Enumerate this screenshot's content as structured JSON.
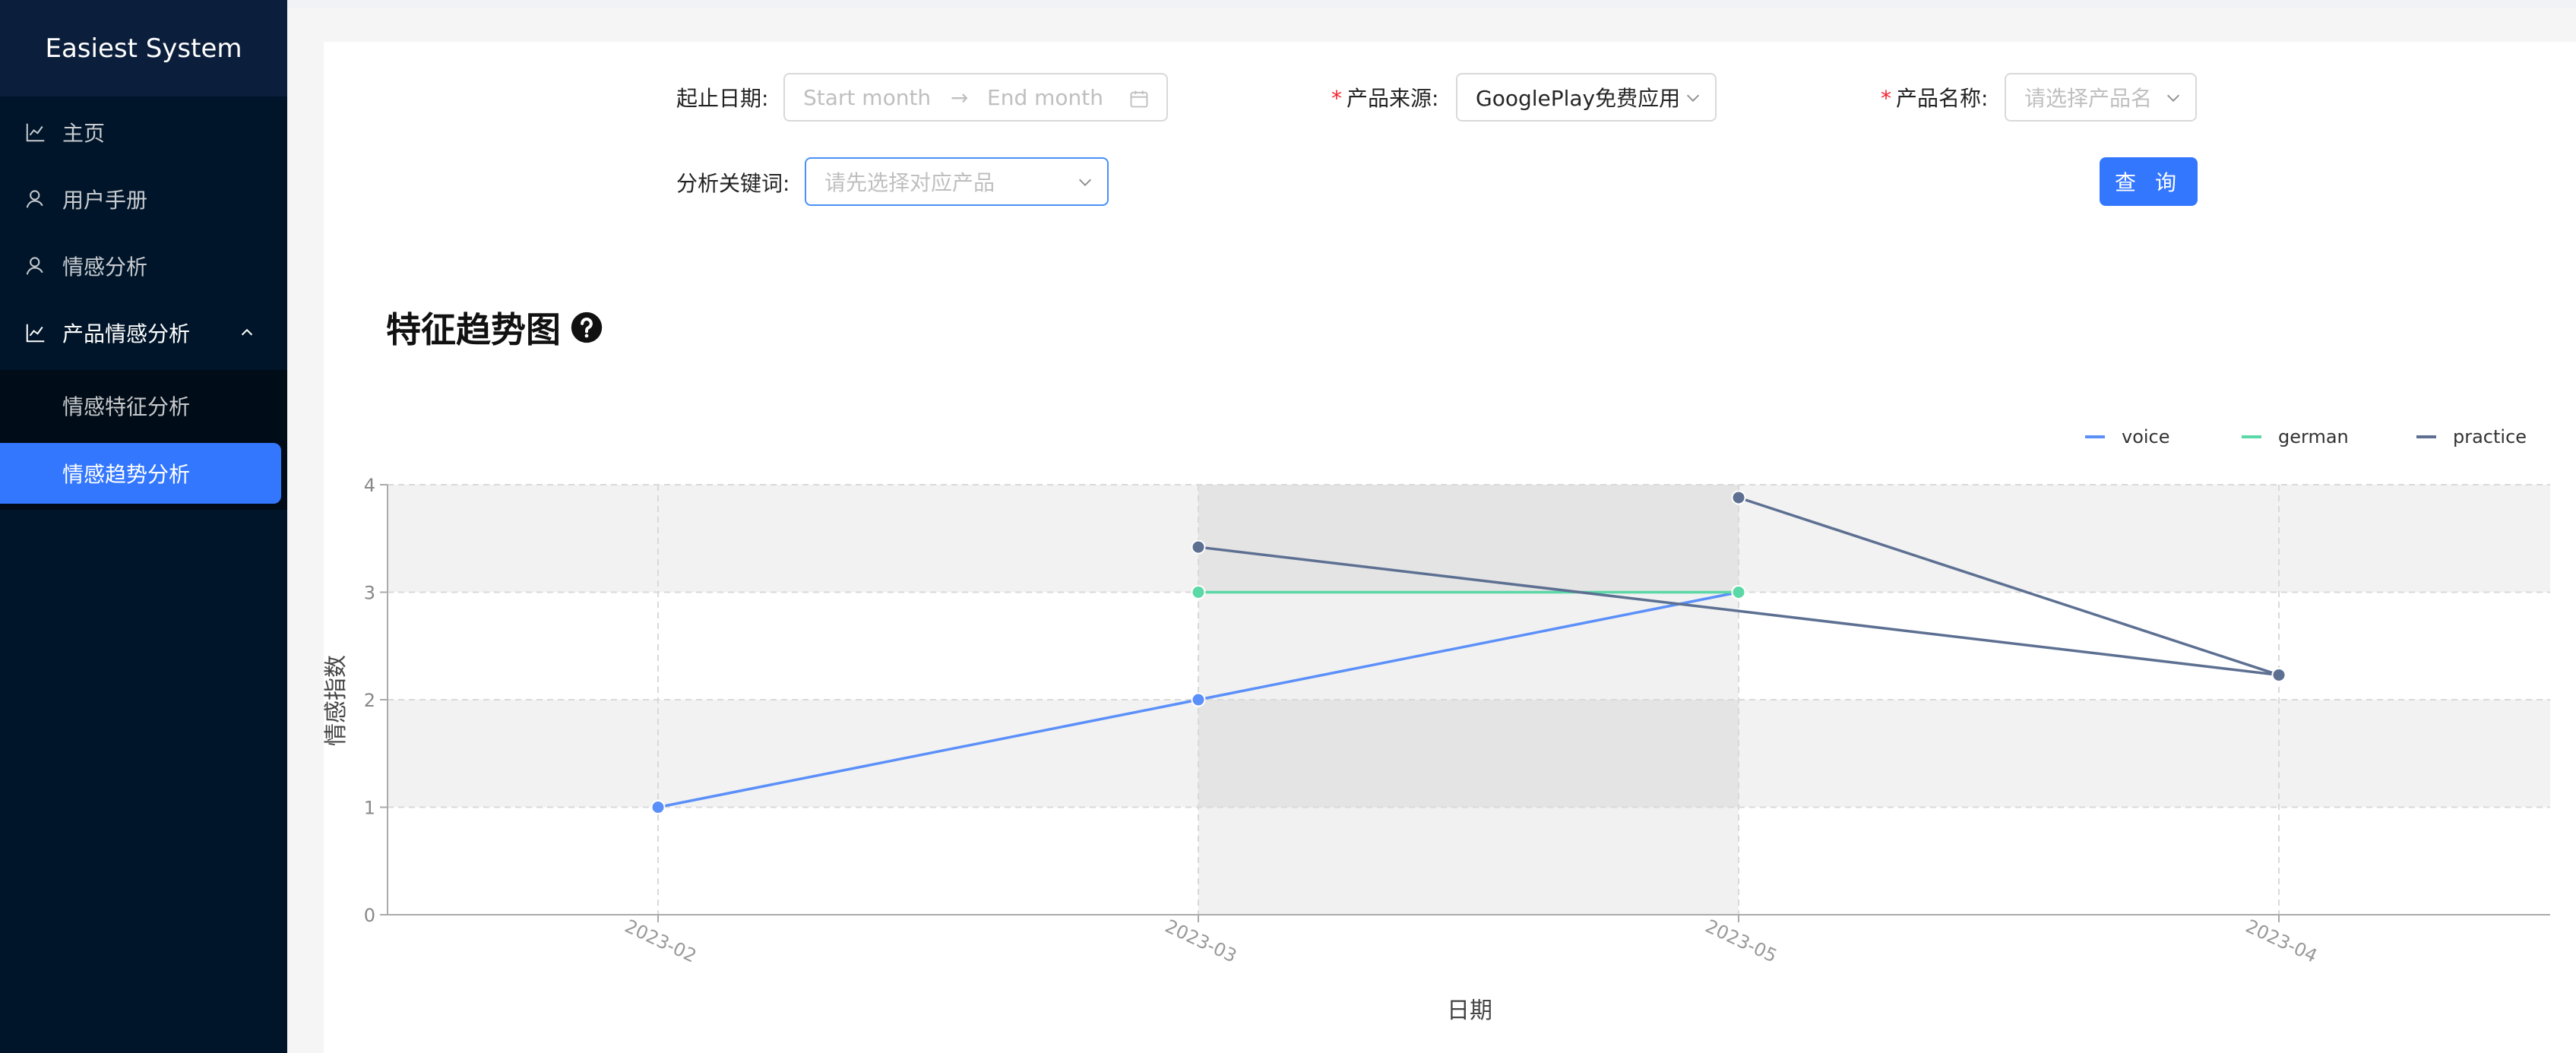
{
  "app": {
    "title": "Easiest System"
  },
  "sidebar": {
    "items": [
      {
        "label": "主页",
        "icon": "line-chart-icon"
      },
      {
        "label": "用户手册",
        "icon": "user-icon"
      },
      {
        "label": "情感分析",
        "icon": "user-icon"
      },
      {
        "label": "产品情感分析",
        "icon": "line-chart-icon",
        "expanded": true,
        "children": [
          {
            "label": "情感特征分析"
          },
          {
            "label": "情感趋势分析",
            "active": true
          }
        ]
      }
    ]
  },
  "form": {
    "date_label": "起止日期:",
    "start_placeholder": "Start month",
    "end_placeholder": "End month",
    "range_sep": "→",
    "source_label": "产品来源:",
    "source_value": "GooglePlay免费应用",
    "name_label": "产品名称:",
    "name_placeholder": "请选择产品名",
    "keyword_label": "分析关键词:",
    "keyword_placeholder": "请先选择对应产品",
    "query_button": "查 询",
    "required_mark": "*"
  },
  "chart": {
    "title": "特征趋势图"
  },
  "chart_data": {
    "type": "line",
    "x": [
      "2023-02",
      "2023-03",
      "2023-05",
      "2023-04"
    ],
    "series": [
      {
        "name": "voice",
        "color": "#5b8ff9",
        "values": [
          1,
          2,
          3,
          null
        ]
      },
      {
        "name": "german",
        "color": "#5ad8a6",
        "values": [
          null,
          3,
          3,
          null
        ]
      },
      {
        "name": "practice",
        "color": "#5d7092",
        "values": [
          null,
          3.42,
          null,
          2.23
        ]
      },
      {
        "name": "practice",
        "color": "#5d7092",
        "values": [
          null,
          null,
          3.88,
          2.23
        ],
        "hidden_in_legend": true
      }
    ],
    "xlabel": "日期",
    "ylabel": "情感指数",
    "ylim": [
      0,
      4
    ],
    "yticks": [
      "0",
      "1",
      "2",
      "3",
      "4"
    ],
    "legend": "top-right",
    "grid": true
  }
}
